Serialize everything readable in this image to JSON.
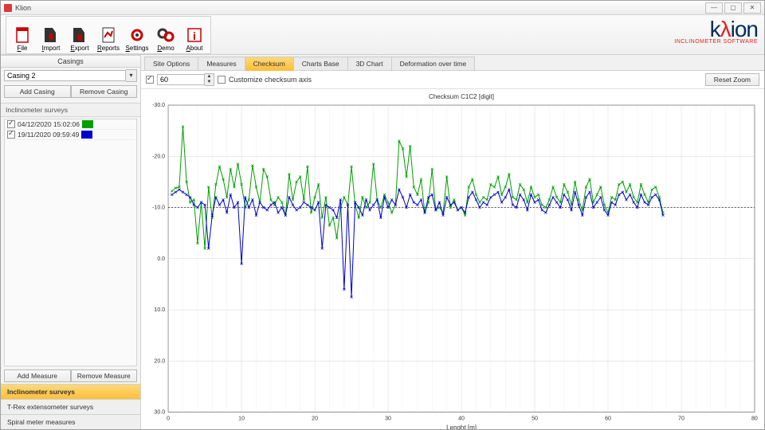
{
  "window": {
    "title": "Klion"
  },
  "toolbar": {
    "file": "File",
    "import": "Import",
    "export": "Export",
    "reports": "Reports",
    "settings": "Settings",
    "demo": "Demo",
    "about": "About",
    "file_u": "F",
    "import_u": "I",
    "export_u": "E",
    "reports_u": "R",
    "settings_u": "S",
    "demo_u": "D",
    "about_u": "A"
  },
  "logo": {
    "brand1": "k",
    "brand2": "λ",
    "brand3": "ion",
    "sub": "INCLINOMETER SOFTWARE"
  },
  "sidebar": {
    "casings_header": "Casings",
    "casing_value": "Casing 2",
    "add_casing": "Add Casing",
    "remove_casing": "Remove Casing",
    "surveys_label": "Inclinometer surveys",
    "surveys": [
      {
        "label": "04/12/2020 15:02:06",
        "color": "#00a000"
      },
      {
        "label": "19/11/2020 09:59:49",
        "color": "#0000d0"
      }
    ],
    "add_measure": "Add Measure",
    "remove_measure": "Remove Measure",
    "sections": [
      {
        "label": "Inclinometer surveys",
        "active": true
      },
      {
        "label": "T-Rex extensometer surveys",
        "active": false
      },
      {
        "label": "Spiral meter measures",
        "active": false
      }
    ]
  },
  "tabs": [
    "Site Options",
    "Measures",
    "Checksum",
    "Charts Base",
    "3D Chart",
    "Deformation over time"
  ],
  "active_tab": "Checksum",
  "opts": {
    "spin_value": "60",
    "customize": "Customize checksum axis",
    "reset_zoom": "Reset Zoom"
  },
  "chart_data": {
    "type": "line",
    "title": "Checksum C1C2 [digit]",
    "xlabel": "Lenght [m]",
    "ylabel": "",
    "ref_line": -10.0,
    "x": [
      0.5,
      1,
      1.5,
      2,
      2.5,
      3,
      3.5,
      4,
      4.5,
      5,
      5.5,
      6,
      6.5,
      7,
      7.5,
      8,
      8.5,
      9,
      9.5,
      10,
      10.5,
      11,
      11.5,
      12,
      12.5,
      13,
      13.5,
      14,
      14.5,
      15,
      15.5,
      16,
      16.5,
      17,
      17.5,
      18,
      18.5,
      19,
      19.5,
      20,
      20.5,
      21,
      21.5,
      22,
      22.5,
      23,
      23.5,
      24,
      24.5,
      25,
      25.5,
      26,
      26.5,
      27,
      27.5,
      28,
      28.5,
      29,
      29.5,
      30,
      30.5,
      31,
      31.5,
      32,
      32.5,
      33,
      33.5,
      34,
      34.5,
      35,
      35.5,
      36,
      36.5,
      37,
      37.5,
      38,
      38.5,
      39,
      39.5,
      40,
      40.5,
      41,
      41.5,
      42,
      42.5,
      43,
      43.5,
      44,
      44.5,
      45,
      45.5,
      46,
      46.5,
      47,
      47.5,
      48,
      48.5,
      49,
      49.5,
      50,
      50.5,
      51,
      51.5,
      52,
      52.5,
      53,
      53.5,
      54,
      54.5,
      55,
      55.5,
      56,
      56.5,
      57,
      57.5,
      58,
      58.5,
      59,
      59.5,
      60,
      60.5,
      61,
      61.5,
      62,
      62.5,
      63,
      63.5,
      64,
      64.5,
      65,
      65.5,
      66,
      66.5,
      67,
      67.5
    ],
    "xlim": [
      0,
      80
    ],
    "ylim": [
      -30,
      30
    ],
    "xticks": [
      0,
      10,
      20,
      30,
      40,
      50,
      60,
      70,
      80
    ],
    "yticks": [
      -30,
      -20,
      -10,
      0,
      10,
      20,
      30
    ],
    "series": [
      {
        "name": "04/12/2020 15:02:06",
        "color": "#00a000",
        "values": [
          -13.2,
          -13.8,
          -14.0,
          -25.8,
          -15.0,
          -11.0,
          -11.5,
          -3.0,
          -11.0,
          -2.0,
          -14.0,
          -8.0,
          -14.5,
          -18.0,
          -15.5,
          -12.0,
          -17.5,
          -14.0,
          -18.5,
          -14.5,
          -10.0,
          -11.5,
          -18.2,
          -14.0,
          -11.0,
          -17.5,
          -16.0,
          -11.5,
          -10.5,
          -12.0,
          -11.0,
          -8.5,
          -16.5,
          -11.5,
          -15.0,
          -16.0,
          -11.5,
          -18.0,
          -9.0,
          -12.0,
          -14.5,
          -8.0,
          -12.0,
          -6.5,
          -8.0,
          -4.0,
          -10.0,
          -12.0,
          -10.5,
          -18.0,
          -10.5,
          -8.0,
          -12.0,
          -10.0,
          -11.0,
          -18.5,
          -11.5,
          -10.0,
          -12.5,
          -11.0,
          -9.0,
          -10.5,
          -23.0,
          -21.5,
          -16.0,
          -22.0,
          -14.0,
          -12.5,
          -15.5,
          -9.0,
          -11.0,
          -17.5,
          -9.5,
          -10.0,
          -9.0,
          -16.0,
          -10.0,
          -11.5,
          -9.5,
          -10.0,
          -8.5,
          -14.0,
          -15.5,
          -12.5,
          -11.0,
          -12.0,
          -11.5,
          -14.5,
          -14.0,
          -16.0,
          -12.5,
          -14.0,
          -16.5,
          -12.0,
          -11.5,
          -14.5,
          -13.5,
          -11.0,
          -14.0,
          -12.0,
          -12.5,
          -10.5,
          -10.0,
          -11.5,
          -14.0,
          -12.0,
          -11.0,
          -14.5,
          -13.0,
          -10.5,
          -15.0,
          -11.5,
          -9.5,
          -14.0,
          -15.5,
          -11.0,
          -12.5,
          -14.0,
          -10.5,
          -9.0,
          -12.0,
          -11.5,
          -14.5,
          -15.0,
          -13.0,
          -14.5,
          -12.0,
          -11.0,
          -14.5,
          -12.5,
          -11.0,
          -13.5,
          -14.0,
          -12.0,
          -9.0
        ]
      },
      {
        "name": "19/11/2020 09:59:49",
        "color": "#0000d0",
        "values": [
          -12.5,
          -13.0,
          -13.5,
          -13.0,
          -12.5,
          -12.0,
          -10.5,
          -10.0,
          -11.0,
          -10.5,
          -2.0,
          -8.5,
          -12.0,
          -10.5,
          -11.5,
          -9.0,
          -12.5,
          -10.0,
          -11.0,
          1.0,
          -12.0,
          -10.0,
          -11.5,
          -8.5,
          -11.0,
          -10.0,
          -9.5,
          -10.5,
          -11.0,
          -9.0,
          -10.0,
          -8.5,
          -12.0,
          -10.5,
          -9.5,
          -10.0,
          -11.0,
          -10.5,
          -10.0,
          -9.5,
          -11.0,
          -2.0,
          -10.5,
          -10.0,
          -9.5,
          -8.0,
          -11.5,
          6.0,
          -10.5,
          7.5,
          -11.0,
          -10.0,
          -8.5,
          -11.5,
          -9.5,
          -10.5,
          -11.5,
          -8.0,
          -12.0,
          -10.0,
          -11.5,
          -10.5,
          -13.5,
          -12.0,
          -10.0,
          -12.5,
          -11.0,
          -10.5,
          -11.5,
          -9.0,
          -12.0,
          -12.5,
          -9.5,
          -11.0,
          -8.5,
          -12.0,
          -10.5,
          -11.0,
          -9.5,
          -10.0,
          -9.0,
          -12.0,
          -13.0,
          -11.5,
          -10.0,
          -11.0,
          -10.5,
          -12.0,
          -12.5,
          -13.0,
          -11.0,
          -12.0,
          -13.5,
          -10.5,
          -10.0,
          -12.5,
          -11.5,
          -9.5,
          -12.5,
          -11.0,
          -11.5,
          -9.5,
          -9.0,
          -10.5,
          -12.0,
          -11.0,
          -10.0,
          -12.5,
          -11.5,
          -9.5,
          -13.0,
          -10.5,
          -8.5,
          -12.0,
          -13.0,
          -10.0,
          -11.0,
          -12.0,
          -9.5,
          -8.5,
          -11.0,
          -10.5,
          -12.5,
          -13.0,
          -11.5,
          -12.5,
          -11.0,
          -10.0,
          -12.5,
          -11.0,
          -10.5,
          -12.0,
          -12.5,
          -11.5,
          -8.5
        ]
      }
    ]
  }
}
